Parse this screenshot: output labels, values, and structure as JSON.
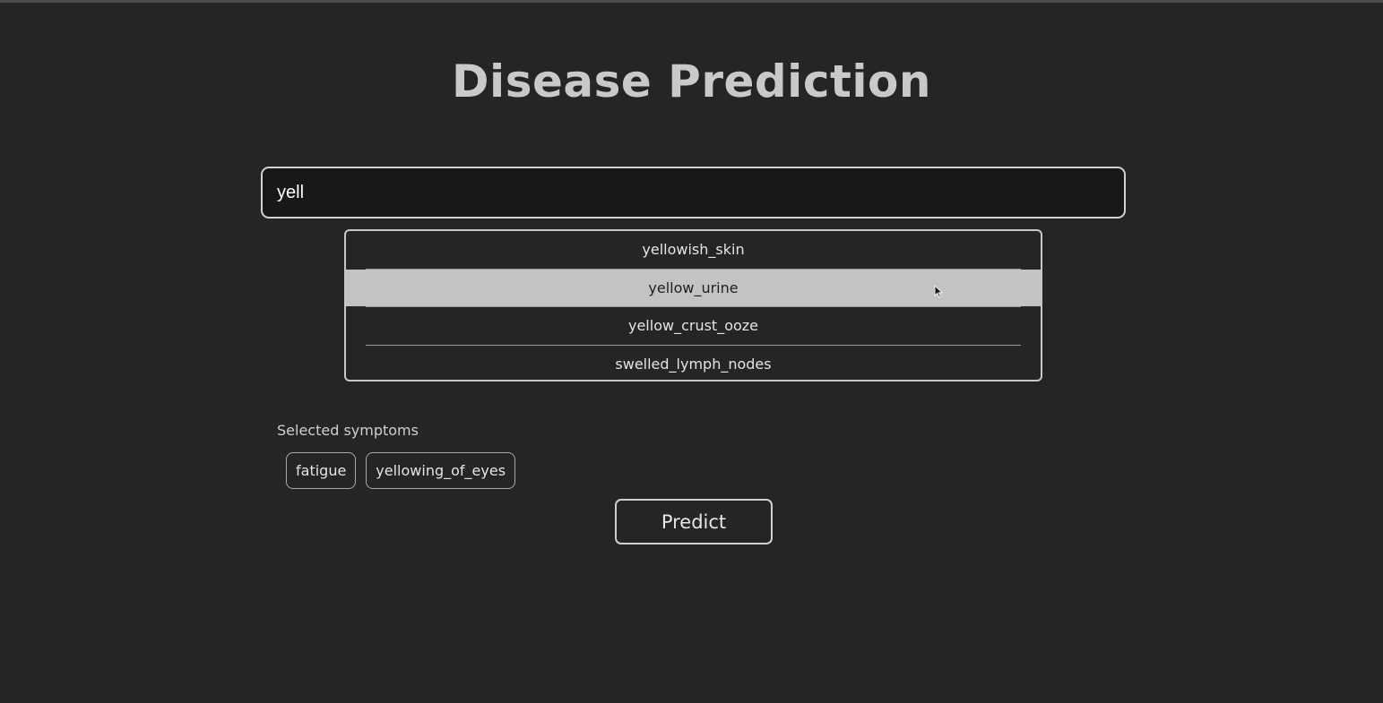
{
  "page": {
    "title": "Disease Prediction"
  },
  "search": {
    "value": "yell",
    "placeholder": ""
  },
  "suggestions": [
    {
      "label": "yellowish_skin",
      "highlighted": false
    },
    {
      "label": "yellow_urine",
      "highlighted": true
    },
    {
      "label": "yellow_crust_ooze",
      "highlighted": false
    },
    {
      "label": "swelled_lymph_nodes",
      "highlighted": false
    }
  ],
  "selected": {
    "label": "Selected symptoms",
    "chips": [
      "fatigue",
      "yellowing_of_eyes"
    ]
  },
  "actions": {
    "predict_label": "Predict"
  },
  "icons": {
    "pointer": "mouse-pointer-icon"
  },
  "colors": {
    "background": "#252525",
    "input_background": "#181818",
    "highlight": "#c3c3c3",
    "border": "#d2d2d2"
  }
}
